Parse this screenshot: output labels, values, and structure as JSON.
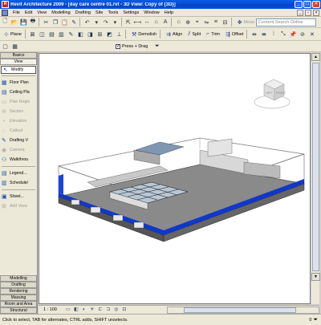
{
  "window": {
    "title": "Revit Architecture 2009 - [day care centre 01.rvt - 3D View: Copy of {3D}]",
    "app_icon": "R"
  },
  "menubar": {
    "items": [
      "File",
      "Edit",
      "View",
      "Modelling",
      "Drafting",
      "Site",
      "Tools",
      "Settings",
      "Window",
      "Help"
    ]
  },
  "toolbar1": {
    "search_placeholder": "Content Search Online",
    "move_label": "Move"
  },
  "toolbar2": {
    "plane_label": "Plane",
    "demolish_label": "Demolish",
    "align_label": "Align",
    "split_label": "Split",
    "trim_label": "Trim",
    "offset_label": "Offset"
  },
  "toolbar3": {
    "press_drag_label": "Press + Drag",
    "press_drag_checked": true
  },
  "sidebar": {
    "top_tabs": [
      "Basics",
      "View"
    ],
    "items": [
      {
        "label": "Modify",
        "icon": "arrow-icon",
        "enabled": true
      },
      {
        "label": "Floor Plan",
        "icon": "floor-plan-icon",
        "enabled": true
      },
      {
        "label": "Ceiling Pla",
        "icon": "ceiling-plan-icon",
        "enabled": true
      },
      {
        "label": "Plan Regio",
        "icon": "plan-region-icon",
        "enabled": false
      },
      {
        "label": "Section",
        "icon": "section-icon",
        "enabled": false
      },
      {
        "label": "Elevation",
        "icon": "elevation-icon",
        "enabled": false
      },
      {
        "label": "Callout",
        "icon": "callout-icon",
        "enabled": false
      },
      {
        "label": "Drafting V",
        "icon": "drafting-view-icon",
        "enabled": true
      },
      {
        "label": "Camera",
        "icon": "camera-icon",
        "enabled": false
      },
      {
        "label": "Walkthrou",
        "icon": "walkthrough-icon",
        "enabled": true
      },
      {
        "label": "Legend...",
        "icon": "legend-icon",
        "enabled": true
      },
      {
        "label": "Schedule/",
        "icon": "schedule-icon",
        "enabled": true
      },
      {
        "label": "Sheet...",
        "icon": "sheet-icon",
        "enabled": true
      },
      {
        "label": "Add View",
        "icon": "add-view-icon",
        "enabled": false
      }
    ],
    "bottom_tabs": [
      "Modelling",
      "Drafting",
      "Rendering",
      "Massing",
      "Room and Area",
      "Structural"
    ]
  },
  "viewbar": {
    "scale": "1 : 100"
  },
  "status": {
    "message": "Click to select, TAB for alternates, CTRL adds, SHIFT unselects.",
    "counter": "0"
  },
  "viewcube": {
    "faces": [
      "LEFT",
      "FRONT"
    ]
  }
}
